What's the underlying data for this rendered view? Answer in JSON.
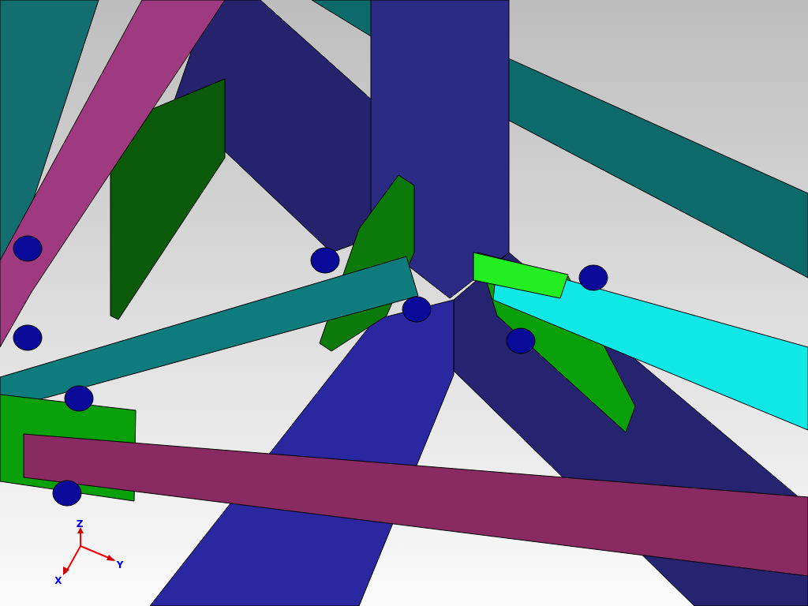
{
  "viewport": {
    "axis_triad": {
      "labels": [
        "Z",
        "Y",
        "X"
      ]
    }
  }
}
